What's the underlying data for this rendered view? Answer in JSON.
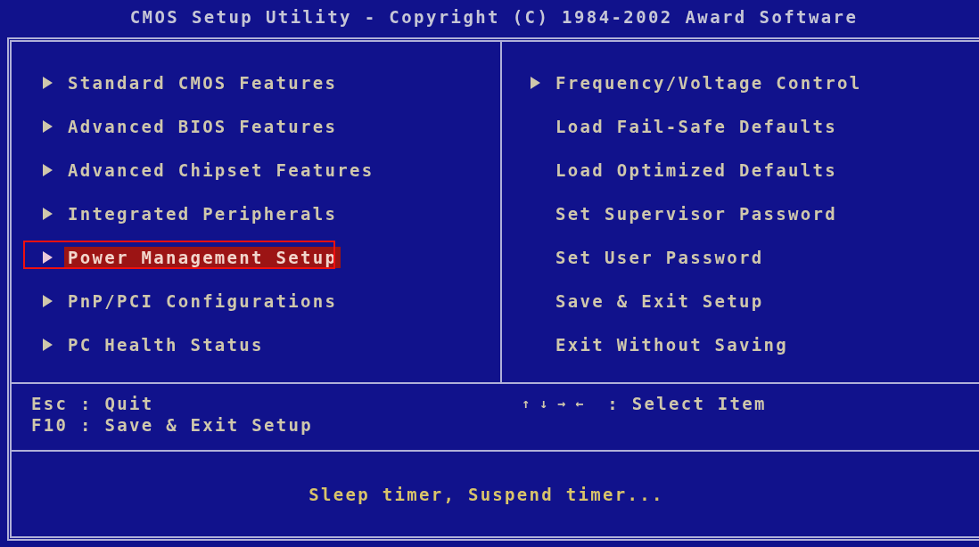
{
  "window": {
    "title": "CMOS Setup Utility - Copyright (C) 1984-2002 Award Software"
  },
  "menu_left": [
    {
      "label": "Standard CMOS Features",
      "submenu": true,
      "selected": false
    },
    {
      "label": "Advanced BIOS Features",
      "submenu": true,
      "selected": false
    },
    {
      "label": "Advanced Chipset Features",
      "submenu": true,
      "selected": false
    },
    {
      "label": "Integrated Peripherals",
      "submenu": true,
      "selected": false
    },
    {
      "label": "Power Management Setup",
      "submenu": true,
      "selected": true
    },
    {
      "label": "PnP/PCI Configurations",
      "submenu": true,
      "selected": false
    },
    {
      "label": "PC Health Status",
      "submenu": true,
      "selected": false
    }
  ],
  "menu_right": [
    {
      "label": "Frequency/Voltage Control",
      "submenu": true,
      "selected": false
    },
    {
      "label": "Load Fail-Safe Defaults",
      "submenu": false,
      "selected": false
    },
    {
      "label": "Load Optimized Defaults",
      "submenu": false,
      "selected": false
    },
    {
      "label": "Set Supervisor Password",
      "submenu": false,
      "selected": false
    },
    {
      "label": "Set User Password",
      "submenu": false,
      "selected": false
    },
    {
      "label": "Save & Exit Setup",
      "submenu": false,
      "selected": false
    },
    {
      "label": "Exit Without Saving",
      "submenu": false,
      "selected": false
    }
  ],
  "key_help": [
    "Esc : Quit",
    "F10 : Save & Exit Setup"
  ],
  "nav_help": {
    "keys": "↑ ↓ → ←",
    "action": ": Select Item"
  },
  "status_bar": "Sleep timer, Suspend timer..."
}
